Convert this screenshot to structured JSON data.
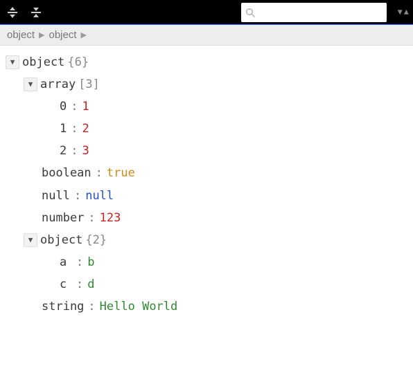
{
  "toolbar": {
    "search_placeholder": ""
  },
  "breadcrumb": {
    "items": [
      "object",
      "object"
    ]
  },
  "tree": {
    "root_label": "object",
    "root_count": "{6}",
    "array": {
      "label": "array",
      "count": "[3]",
      "items": [
        {
          "key": "0",
          "value": "1"
        },
        {
          "key": "1",
          "value": "2"
        },
        {
          "key": "2",
          "value": "3"
        }
      ]
    },
    "boolean": {
      "key": "boolean",
      "value": "true"
    },
    "null": {
      "key": "null",
      "value": "null"
    },
    "number": {
      "key": "number",
      "value": "123"
    },
    "object": {
      "label": "object",
      "count": "{2}",
      "items": [
        {
          "key": "a",
          "value": "b"
        },
        {
          "key": "c",
          "value": "d"
        }
      ]
    },
    "string": {
      "key": "string",
      "value": "Hello World"
    }
  }
}
